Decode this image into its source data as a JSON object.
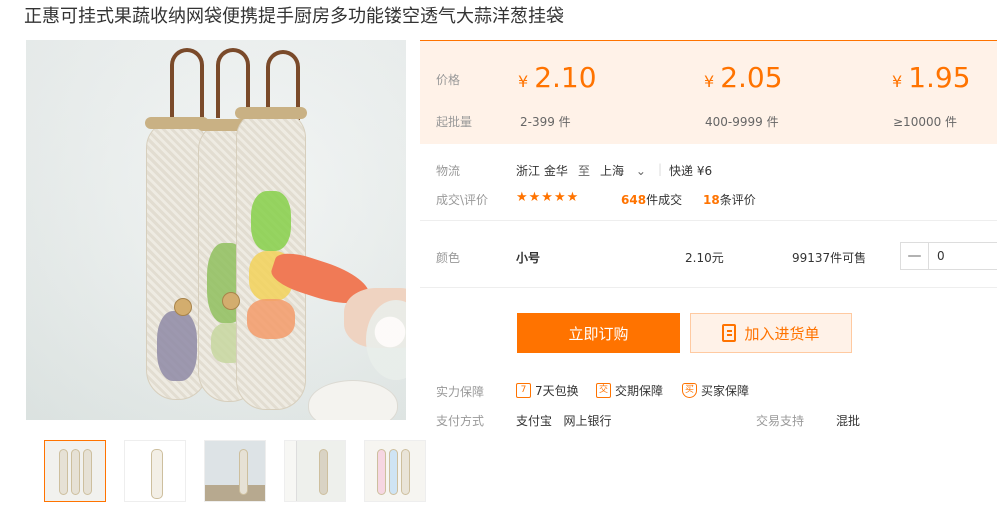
{
  "product": {
    "title": "正惠可挂式果蔬收纳网袋便携提手厨房多功能镂空透气大蒜洋葱挂袋"
  },
  "price_panel": {
    "price_label": "价格",
    "qty_label": "起批量",
    "currency": "¥",
    "tiers": [
      {
        "price": "2.10",
        "qty": "2-399 件"
      },
      {
        "price": "2.05",
        "qty": "400-9999 件"
      },
      {
        "price": "1.95",
        "qty": "≥10000 件"
      }
    ]
  },
  "logistics": {
    "label": "物流",
    "from": "浙江 金华",
    "to_word": "至",
    "to": "上海",
    "shipping": "快递 ¥6"
  },
  "reviews": {
    "label": "成交\\评价",
    "stars": "★★★★★",
    "deals_count": "648",
    "deals_suffix": "件成交",
    "review_count": "18",
    "review_suffix": "条评价"
  },
  "sku": {
    "label": "颜色",
    "name": "小号",
    "price": "2.10元",
    "stock": "99137件可售",
    "quantity": "0",
    "minus": "—"
  },
  "actions": {
    "order": "立即订购",
    "cart": "加入进货单"
  },
  "guarantee": {
    "label": "实力保障",
    "items": [
      {
        "icon_text": "7",
        "label": "7天包换"
      },
      {
        "icon_text": "交",
        "label": "交期保障"
      },
      {
        "icon_text": "买",
        "label": "买家保障"
      }
    ]
  },
  "payment": {
    "label": "支付方式",
    "methods": "支付宝   网上银行",
    "trade_label": "交易支持",
    "trade_value": "混批"
  },
  "colors": {
    "accent": "#ff7300",
    "panel_bg": "#fff2e8"
  }
}
